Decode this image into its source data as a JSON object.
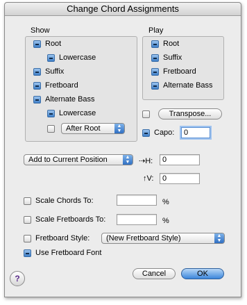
{
  "window": {
    "title": "Change Chord Assignments"
  },
  "show": {
    "label": "Show",
    "items": [
      {
        "label": "Root",
        "checked": true
      },
      {
        "label": "Lowercase",
        "checked": true
      },
      {
        "label": "Suffix",
        "checked": true
      },
      {
        "label": "Fretboard",
        "checked": true
      },
      {
        "label": "Alternate Bass",
        "checked": true
      },
      {
        "label": "Lowercase",
        "checked": true
      }
    ],
    "bass_position": {
      "checked": false,
      "value": "After Root"
    }
  },
  "play": {
    "label": "Play",
    "items": [
      {
        "label": "Root",
        "checked": true
      },
      {
        "label": "Suffix",
        "checked": true
      },
      {
        "label": "Fretboard",
        "checked": true
      },
      {
        "label": "Alternate Bass",
        "checked": true
      }
    ]
  },
  "transpose": {
    "checked": false,
    "button_label": "Transpose..."
  },
  "capo": {
    "checked": true,
    "label": "Capo:",
    "value": "0"
  },
  "position": {
    "popup_value": "Add to Current Position",
    "h_label": "H:",
    "h_value": "0",
    "v_label": "V:",
    "v_value": "0"
  },
  "scale_chords": {
    "checked": false,
    "label": "Scale Chords To:",
    "value": "",
    "unit": "%"
  },
  "scale_fretboards": {
    "checked": false,
    "label": "Scale Fretboards To:",
    "value": "",
    "unit": "%"
  },
  "fretboard_style": {
    "checked": false,
    "label": "Fretboard Style:",
    "value": "(New Fretboard Style)"
  },
  "fretboard_font": {
    "checked": true,
    "label": "Use Fretboard Font"
  },
  "buttons": {
    "cancel": "Cancel",
    "ok": "OK",
    "help": "?"
  }
}
